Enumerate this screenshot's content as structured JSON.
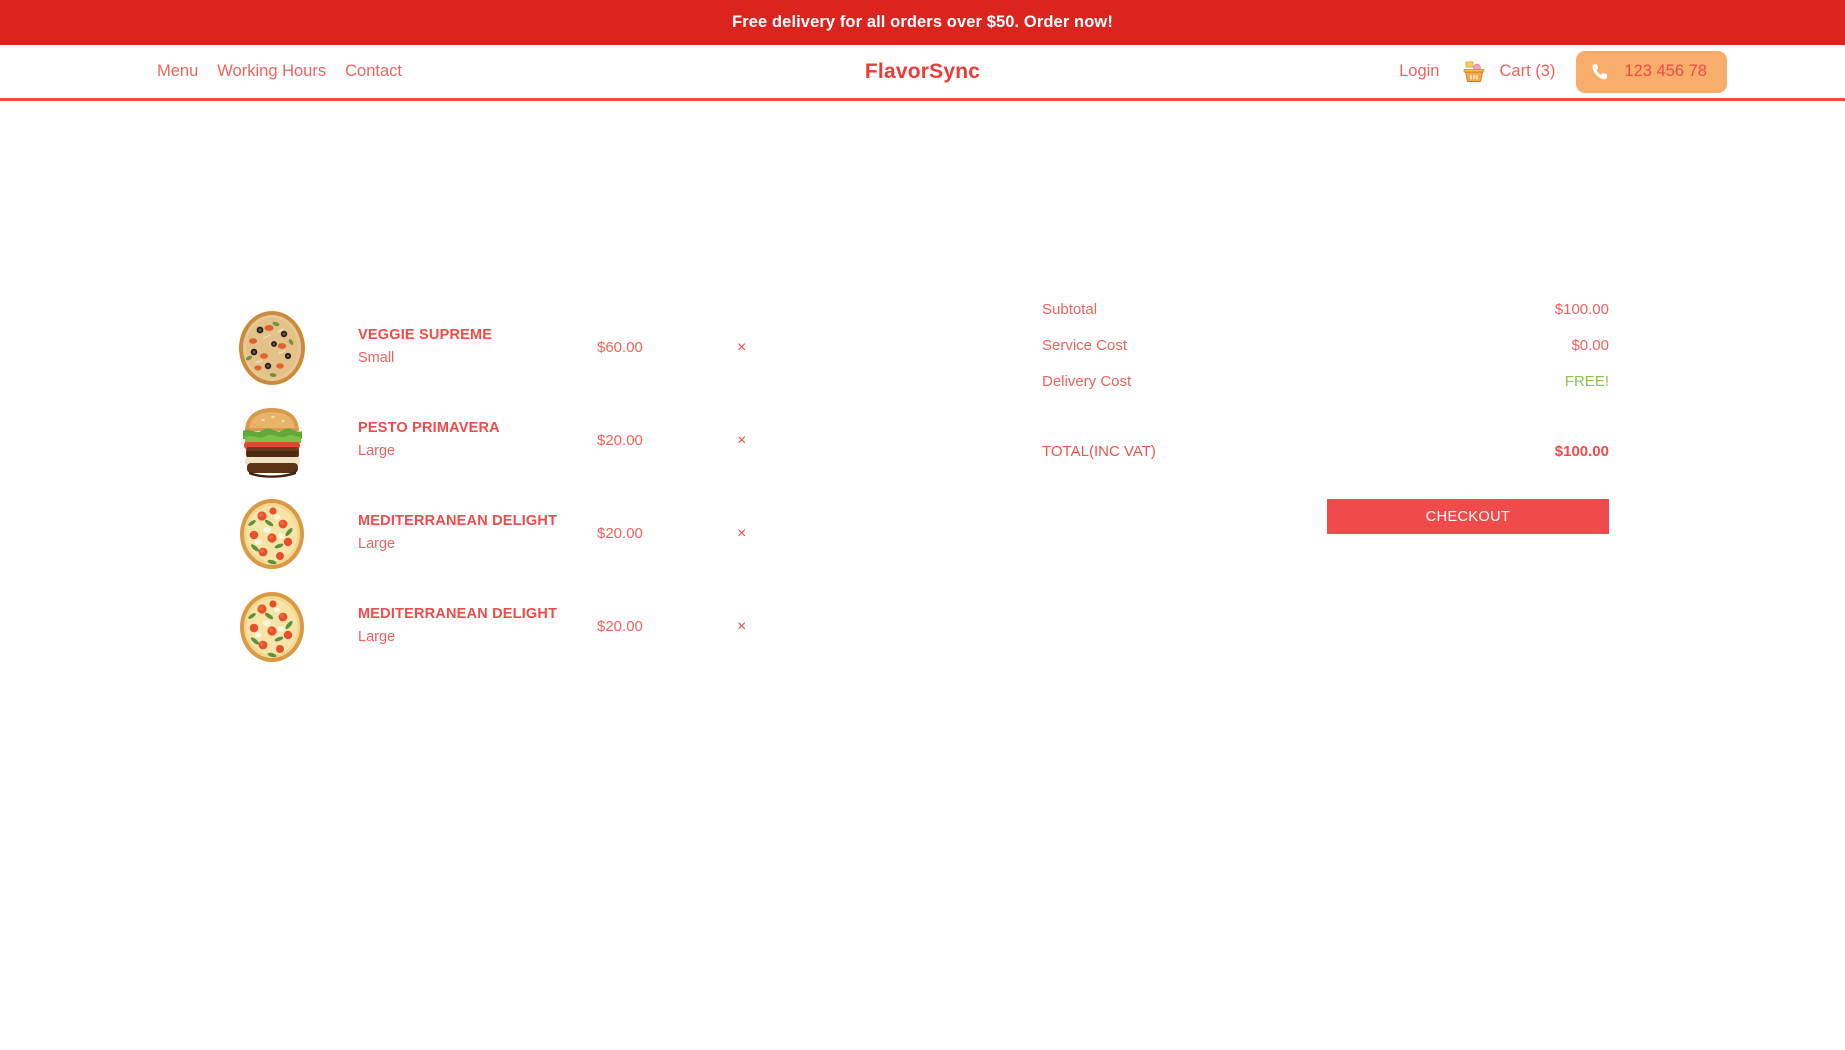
{
  "promo": {
    "text": "Free delivery for all orders over $50. Order now!",
    "background": "#dc241f"
  },
  "header": {
    "brand": "FlavorSync",
    "nav": [
      {
        "label": "Menu",
        "name": "nav-link-menu"
      },
      {
        "label": "Working Hours",
        "name": "nav-link-working-hours"
      },
      {
        "label": "Contact",
        "name": "nav-link-contact"
      }
    ],
    "login_label": "Login",
    "basket_icon": "shopping-basket-icon",
    "cart_label": "Cart (3)",
    "cart_count": 3,
    "phone_icon": "phone-icon",
    "phone_number": "123 456 78",
    "phone_button_color": "#f9ad6a",
    "accent": "#ef4b4b",
    "link_color": "#f0635e"
  },
  "cart": {
    "items": [
      {
        "name": "VEGGIE SUPREME",
        "size": "Small",
        "price": "$60.00",
        "remove": "×",
        "thumb": "veggie-supreme-pizza-image"
      },
      {
        "name": "PESTO PRIMAVERA",
        "size": "Large",
        "price": "$20.00",
        "remove": "×",
        "thumb": "pesto-primavera-burger-image"
      },
      {
        "name": "MEDITERRANEAN DELIGHT",
        "size": "Large",
        "price": "$20.00",
        "remove": "×",
        "thumb": "mediterranean-delight-pizza-image"
      },
      {
        "name": "MEDITERRANEAN DELIGHT",
        "size": "Large",
        "price": "$20.00",
        "remove": "×",
        "thumb": "mediterranean-delight-pizza-image"
      }
    ]
  },
  "summary": {
    "subtotal_label": "Subtotal",
    "subtotal_value": "$100.00",
    "service_label": "Service Cost",
    "service_value": "$0.00",
    "delivery_label": "Delivery Cost",
    "delivery_value": "FREE!",
    "delivery_value_color": "#8cc152",
    "total_label": "TOTAL(INC VAT)",
    "total_value": "$100.00",
    "checkout_label": "CHECKOUT",
    "checkout_color": "#ef4b4b"
  }
}
